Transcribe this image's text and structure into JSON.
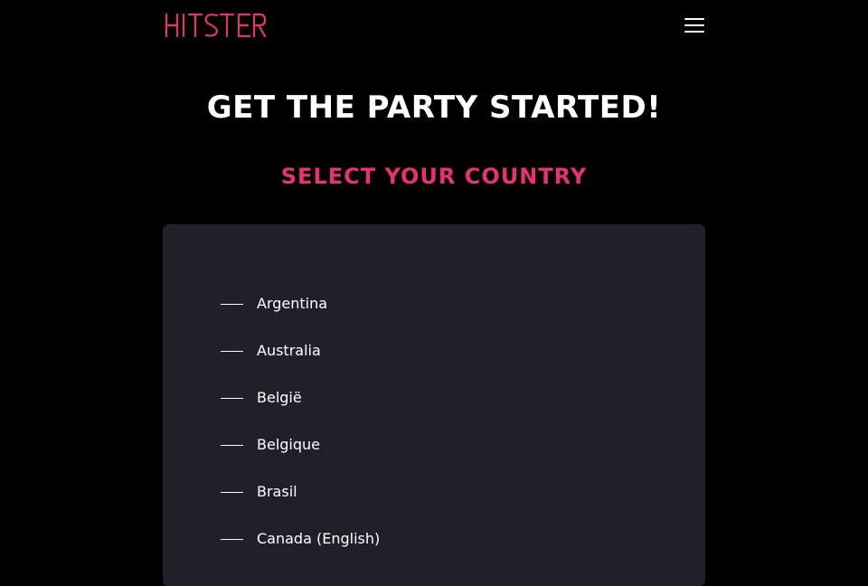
{
  "header": {
    "logo_text": "HITSTER",
    "logo_color": "#e8326f",
    "menu_icon": "hamburger-menu-icon"
  },
  "main": {
    "headline": "GET THE PARTY STARTED!",
    "subheadline": "SELECT YOUR COUNTRY",
    "accent_color": "#e8326f",
    "panel_color": "#1f2029",
    "countries": [
      {
        "label": "Argentina"
      },
      {
        "label": "Australia"
      },
      {
        "label": "België"
      },
      {
        "label": "Belgique"
      },
      {
        "label": "Brasil"
      },
      {
        "label": "Canada (English)"
      }
    ]
  }
}
